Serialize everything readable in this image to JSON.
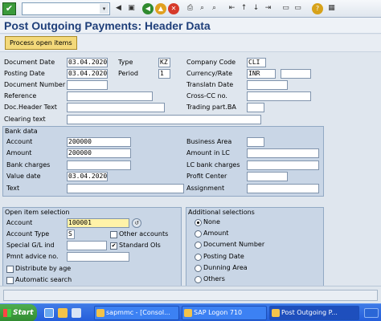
{
  "toolbar": {
    "command_field": "",
    "dropdown_glyph": "▾"
  },
  "title": "Post Outgoing Payments: Header Data",
  "app_toolbar": {
    "process_open_items": "Process open items"
  },
  "header": {
    "document_date_label": "Document Date",
    "document_date": "03.04.2020",
    "type_label": "Type",
    "type": "KZ",
    "company_code_label": "Company Code",
    "company_code": "CLI",
    "posting_date_label": "Posting Date",
    "posting_date": "03.04.2020",
    "period_label": "Period",
    "period": "1",
    "currency_rate_label": "Currency/Rate",
    "currency": "INR",
    "rate": "",
    "document_number_label": "Document Number",
    "document_number": "",
    "translatn_date_label": "Translatn Date",
    "translatn_date": "",
    "reference_label": "Reference",
    "reference": "",
    "cross_cc_label": "Cross-CC no.",
    "cross_cc": "",
    "doc_header_text_label": "Doc.Header Text",
    "doc_header_text": "",
    "trading_part_label": "Trading part.BA",
    "trading_part": "",
    "clearing_text_label": "Clearing text",
    "clearing_text": ""
  },
  "bank_data": {
    "title": "Bank data",
    "account_label": "Account",
    "account": "200000",
    "amount_label": "Amount",
    "amount": "200000",
    "bank_charges_label": "Bank charges",
    "bank_charges": "",
    "value_date_label": "Value date",
    "value_date": "03.04.2020",
    "text_label": "Text",
    "text": "",
    "business_area_label": "Business Area",
    "business_area": "",
    "amount_lc_label": "Amount in LC",
    "amount_lc": "",
    "lc_bank_charges_label": "LC bank charges",
    "lc_bank_charges": "",
    "profit_center_label": "Profit Center",
    "profit_center": "",
    "assignment_label": "Assignment",
    "assignment": ""
  },
  "open_item_selection": {
    "title": "Open item selection",
    "account_label": "Account",
    "account": "100001",
    "account_type_label": "Account Type",
    "account_type": "S",
    "other_accounts_label": "Other accounts",
    "other_accounts_checked": false,
    "special_gl_label": "Special G/L ind",
    "special_gl": "",
    "standard_ois_label": "Standard OIs",
    "standard_ois_checked": true,
    "pmnt_advice_label": "Pmnt advice no.",
    "pmnt_advice": "",
    "distribute_by_age_label": "Distribute by age",
    "automatic_search_label": "Automatic search"
  },
  "additional_selections": {
    "title": "Additional selections",
    "options": [
      "None",
      "Amount",
      "Document Number",
      "Posting Date",
      "Dunning Area",
      "Others"
    ],
    "selected": "None"
  },
  "taskbar": {
    "start_label": "Start",
    "tasks": [
      "sapmmc - [Consol...",
      "SAP Logon 710",
      "Post Outgoing P..."
    ]
  }
}
